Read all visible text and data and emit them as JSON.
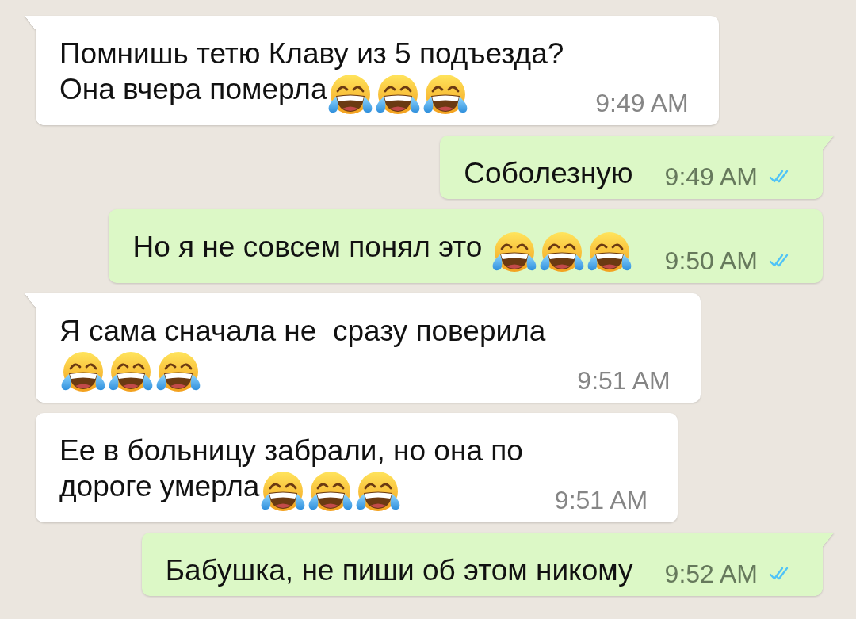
{
  "messages": [
    {
      "kind": "incoming",
      "tail": true,
      "lines": [
        {
          "parts": [
            {
              "kind": "text",
              "text": "Помнишь тетю Клаву из 5 подъезда?"
            }
          ]
        },
        {
          "parts": [
            {
              "kind": "text",
              "text": "Она вчера померла"
            },
            {
              "kind": "emoji"
            },
            {
              "kind": "emoji"
            },
            {
              "kind": "emoji"
            }
          ]
        }
      ],
      "time": "9:49 AM"
    },
    {
      "kind": "outgoing",
      "tail": true,
      "lines": [
        {
          "parts": [
            {
              "kind": "text",
              "text": "Соболезную"
            }
          ]
        }
      ],
      "time": "9:49 AM",
      "read": true
    },
    {
      "kind": "outgoing",
      "tail": false,
      "lines": [
        {
          "parts": [
            {
              "kind": "text",
              "text": "Но я не совсем понял это "
            },
            {
              "kind": "emoji"
            },
            {
              "kind": "emoji"
            },
            {
              "kind": "emoji"
            }
          ]
        }
      ],
      "time": "9:50 AM",
      "read": true
    },
    {
      "kind": "incoming",
      "tail": true,
      "lines": [
        {
          "parts": [
            {
              "kind": "text",
              "text": "Я сама сначала не  сразу поверила"
            }
          ]
        },
        {
          "parts": [
            {
              "kind": "emoji"
            },
            {
              "kind": "emoji"
            },
            {
              "kind": "emoji"
            }
          ]
        }
      ],
      "time": "9:51 AM"
    },
    {
      "kind": "incoming",
      "tail": false,
      "lines": [
        {
          "parts": [
            {
              "kind": "text",
              "text": "Ее в больницу забрали, но она по"
            }
          ]
        },
        {
          "parts": [
            {
              "kind": "text",
              "text": "дороге умерла"
            },
            {
              "kind": "emoji"
            },
            {
              "kind": "emoji"
            },
            {
              "kind": "emoji"
            }
          ]
        }
      ],
      "time": "9:51 AM"
    },
    {
      "kind": "outgoing",
      "tail": true,
      "lines": [
        {
          "parts": [
            {
              "kind": "text",
              "text": "Бабушка, не пиши об этом никому"
            }
          ]
        }
      ],
      "time": "9:52 AM",
      "read": true
    }
  ]
}
